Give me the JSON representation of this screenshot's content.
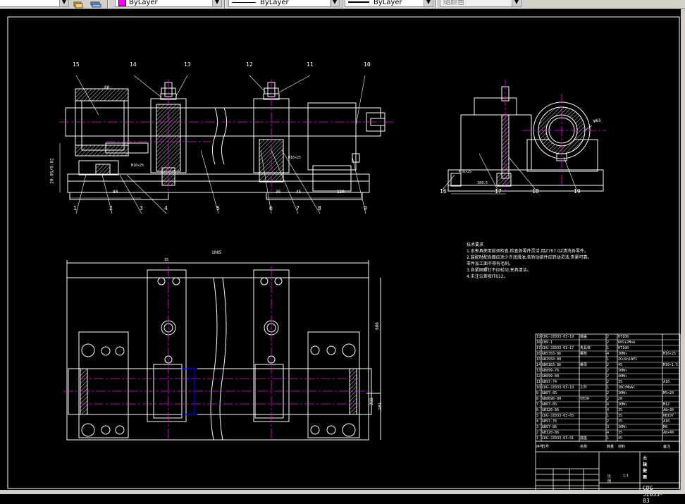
{
  "toolbar": {
    "layer_dropdown_label": "ByLayer",
    "linetype_dropdown_label": "ByLayer",
    "lineweight_dropdown_label": "ByLayer",
    "color_dropdown_label": "随颜色"
  },
  "colors": {
    "background": "#000000",
    "lines": "#ffffff",
    "centerline": "#ff00ff",
    "dimension": "#ffffff",
    "highlight": "#0000ff"
  },
  "drawing": {
    "front_view": {
      "balloons": [
        "1",
        "2",
        "3",
        "4",
        "5",
        "6",
        "7",
        "8",
        "9",
        "10",
        "11",
        "12",
        "13",
        "14",
        "15"
      ],
      "dims": [
        "80",
        "20.05/0.02",
        "M16×25",
        "80",
        "35",
        "45",
        "120",
        "M16×25",
        "35",
        "16"
      ]
    },
    "side_view": {
      "balloons": [
        "16",
        "17",
        "18",
        "19"
      ],
      "dims": [
        "M16×25",
        "φ65",
        "109.5"
      ]
    },
    "top_view": {
      "dims": [
        "1085",
        "35",
        "686",
        "φ80",
        "283",
        "101"
      ]
    },
    "notes": {
      "title": "技术要求",
      "lines": [
        "1.本夹具使用前须检查,检查各零件灵活,用Z707.0Z清洗各零件。",
        "2.装配时配合面应涂少许润滑油,各转动部件应转动灵活,夹紧可靠。",
        "  零件加工面不得有毛刺。",
        "3.各紧固螺钉不应松动,夹具清洁。",
        "4.未注公差按IT612。"
      ]
    },
    "bom": {
      "rows": [
        [
          "19",
          "CDG-JZ033-03-19",
          "端盖",
          "2",
          "HT100",
          ""
        ],
        [
          "18",
          "CB9-1",
          "",
          "2",
          "60Si2MnA",
          ""
        ],
        [
          "17",
          "CDG-JZ033-03-17",
          "夹具体",
          "1",
          "HT100",
          ""
        ],
        [
          "16",
          "GB5783-86",
          "螺栓",
          "4",
          "30Mn",
          "M16×25"
        ],
        [
          "15",
          "GB2550-80",
          "",
          "1",
          "ZCuSn10P1",
          ""
        ],
        [
          "14",
          "GB6183-86",
          "螺母",
          "2",
          "45",
          "M16×1.5"
        ],
        [
          "13",
          "GB899-76",
          "",
          "2",
          "30Mn",
          ""
        ],
        [
          "12",
          "GB899-88",
          "",
          "2",
          "40Mn",
          ""
        ],
        [
          "11",
          "GB97-74",
          "",
          "2",
          "35",
          "A16"
        ],
        [
          "10",
          "CDG-JZ033-03-10",
          "工件",
          "1",
          "38CrMoAl",
          ""
        ],
        [
          "9",
          "GB67-85",
          "",
          "2",
          "30Mn",
          "M5×20"
        ],
        [
          "8",
          "GB8698-80",
          "V形块",
          "2",
          "20",
          ""
        ],
        [
          "7",
          "GB67-85",
          "",
          "4",
          "30Mn",
          "M12"
        ],
        [
          "6",
          "GB120-86",
          "",
          "4",
          "35",
          "A8×30"
        ],
        [
          "5",
          "CDG-JZ033-03-05",
          "",
          "1",
          "35",
          "HB197"
        ],
        [
          "4",
          "GB97-76",
          "",
          "2",
          "35",
          "A16"
        ],
        [
          "3",
          "GB67-86",
          "",
          "3",
          "30Mn",
          "M8"
        ],
        [
          "2",
          "GB120-86",
          "",
          "4",
          "35",
          "A8×40"
        ],
        [
          "1",
          "CDG-JZ033-03-01",
          "底座",
          "1",
          "45",
          ""
        ]
      ],
      "header": [
        "序号",
        "代号",
        "名称",
        "数量",
        "材料",
        "备注"
      ]
    },
    "title_block": {
      "title_line1": "曲轴夹具",
      "title_line2": "装配图",
      "scale_label": "比例",
      "scale_value": "1:1",
      "drawing_number": "CDG-JZ033-03"
    }
  }
}
